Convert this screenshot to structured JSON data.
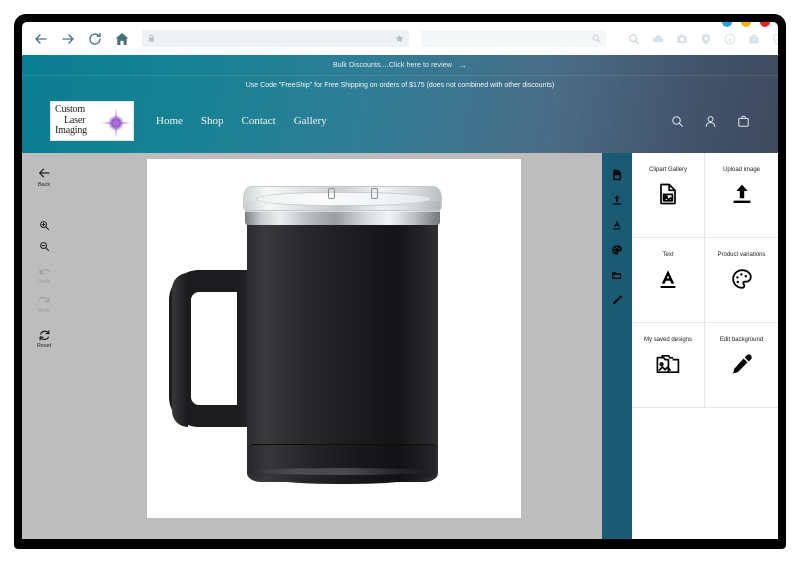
{
  "browser": {
    "nav": {
      "back": "back-arrow",
      "forward": "forward-arrow",
      "reload": "reload",
      "home": "home"
    },
    "address_bar": {
      "value": "",
      "placeholder": "",
      "lock_icon": "lock-icon",
      "bookmark_icon": "star-icon"
    },
    "search_bar": {
      "value": "",
      "placeholder": "",
      "icon": "search-icon"
    },
    "extension_icons": [
      "cloud-icon",
      "camera-icon",
      "shield-download-icon",
      "wifi-icon",
      "briefcase-icon",
      "shield-check-icon",
      "heart-icon",
      "menu-icon"
    ],
    "window_dots": [
      {
        "name": "minimize",
        "color": "#1ca3e8"
      },
      {
        "name": "maximize",
        "color": "#f5b301"
      },
      {
        "name": "close",
        "color": "#f32020"
      }
    ]
  },
  "site": {
    "promo_top": "Bulk Discounts....Click here to review",
    "promo_top_arrow": "→",
    "promo_bottom": "Use Code \"FreeShip\" for Free Shipping on orders of $175 (does not combined with other discounts)",
    "logo": {
      "line1": "Custom",
      "line2": "Laser",
      "line3": "Imaging"
    },
    "nav_items": [
      {
        "label": "Home"
      },
      {
        "label": "Shop"
      },
      {
        "label": "Contact"
      },
      {
        "label": "Gallery"
      }
    ],
    "header_icons": [
      {
        "name": "search-icon"
      },
      {
        "name": "account-icon"
      },
      {
        "name": "cart-icon"
      }
    ],
    "colors": {
      "header_gradient_start": "#0b7e92",
      "header_gradient_end": "#3e4a5e",
      "icon_strip": "#1a5a73",
      "canvas_bg": "#bdbdbd"
    }
  },
  "designer": {
    "left_tools": [
      {
        "name": "back",
        "label": "Back",
        "icon": "arrow-left-icon",
        "disabled": false
      },
      {
        "name": "zoom-in",
        "label": "",
        "icon": "zoom-in-icon",
        "disabled": false
      },
      {
        "name": "zoom-out",
        "label": "",
        "icon": "zoom-out-icon",
        "disabled": false
      },
      {
        "name": "undo",
        "label": "Undo",
        "icon": "undo-icon",
        "disabled": true
      },
      {
        "name": "redo",
        "label": "Redo",
        "icon": "redo-icon",
        "disabled": true
      },
      {
        "name": "reset",
        "label": "Reset",
        "icon": "reset-icon",
        "disabled": false
      }
    ],
    "icon_strip": [
      {
        "name": "clipart-gallery-icon"
      },
      {
        "name": "upload-image-icon"
      },
      {
        "name": "text-icon"
      },
      {
        "name": "product-variations-icon"
      },
      {
        "name": "my-saved-designs-icon"
      },
      {
        "name": "edit-background-icon"
      }
    ],
    "panel_items": [
      {
        "label": "Clipart Gallery",
        "icon": "image-file-icon"
      },
      {
        "label": "Upload image",
        "icon": "upload-arrow-icon"
      },
      {
        "label": "Text",
        "icon": "letter-a-icon"
      },
      {
        "label": "Product variations",
        "icon": "palette-icon"
      },
      {
        "label": "My saved designs",
        "icon": "saved-images-icon"
      },
      {
        "label": "Edit background",
        "icon": "eyedropper-icon"
      }
    ],
    "canvas": {
      "product": "black-insulated-coffee-mug"
    }
  }
}
